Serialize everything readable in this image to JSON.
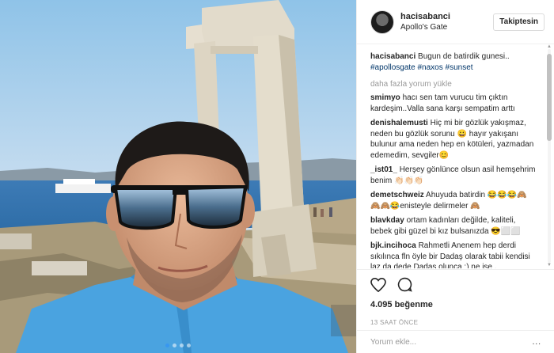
{
  "post": {
    "username": "hacisabanci",
    "location": "Apollo's Gate",
    "follow_label": "Takiptesin",
    "caption": {
      "user": "hacisabanci",
      "text": "Bugun de batirdik gunesi..",
      "hashtags": "#apollosgate #naxos #sunset"
    },
    "load_more": "daha fazla yorum yükle",
    "comments": [
      {
        "user": "smimyo",
        "text": "hacı sen tam vurucu tim çıktın kardeşim..Valla sana karşı sempatim arttı"
      },
      {
        "user": "denishalemusti",
        "text": "Hiç mi bir gözlük yakışmaz, neden bu gözlük sorunu 😀 hayır yakışanı bulunur ama neden hep en kötüleri, yazmadan edemedim, sevgiler😊"
      },
      {
        "user": "_ist01_",
        "text": "Herşey gönlünce olsun asil hemşehrim benim 👏🏻👏🏻👏🏻"
      },
      {
        "user": "demetschweiz",
        "text": "Ahuyuda batirdin 😂😂😂🙈🙈🙈😂enisteyle delirmeler 🙈"
      },
      {
        "user": "blavkday",
        "text": "ortam kadınları değilde, kaliteli, bebek gibi güzel bi kız bulsanızda 😎⬜⬜"
      },
      {
        "user": "bjk.incihoca",
        "text": "Rahmetli Anenem hep derdi sıkılınca fln öyle bir Dadaş olarak tabii kendisi laz da dede Dadaş olunca :) ne ise ."
      }
    ],
    "likes": "4.095 beğenme",
    "time_ago": "13 SAAT ÖNCE",
    "add_comment_placeholder": "Yorum ekle...",
    "more_options": "..."
  },
  "icons": {
    "like": "heart-icon",
    "comment": "comment-bubble-icon",
    "avatar": "profile-avatar"
  },
  "colors": {
    "hashtag": "#003569",
    "carousel_active": "#3897f0",
    "muted": "#999999"
  }
}
